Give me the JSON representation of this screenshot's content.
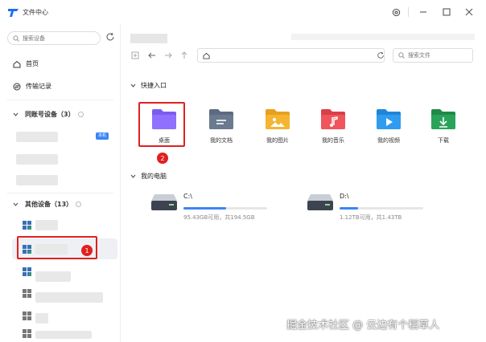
{
  "app": {
    "title": "文件中心"
  },
  "sidebar": {
    "search_placeholder": "搜索设备",
    "nav": [
      {
        "label": "首页",
        "icon": "home-icon"
      },
      {
        "label": "传输记录",
        "icon": "transfer-icon"
      }
    ],
    "groups": [
      {
        "label": "同账号设备（3）"
      },
      {
        "label": "其他设备（13）"
      }
    ],
    "badge": "本机"
  },
  "main": {
    "search_placeholder": "搜索文件",
    "quick_access": {
      "label": "快捷入口",
      "items": [
        {
          "label": "桌面",
          "color": "#7b5cf0"
        },
        {
          "label": "我的文档",
          "color": "#6b7a8f"
        },
        {
          "label": "我的图片",
          "color": "#f5b431"
        },
        {
          "label": "我的音乐",
          "color": "#f0555c"
        },
        {
          "label": "我的视频",
          "color": "#2f9cf0"
        },
        {
          "label": "下载",
          "color": "#2aa35a"
        }
      ]
    },
    "my_computer": {
      "label": "我的电脑",
      "drives": [
        {
          "name": "C:\\",
          "usage": "95.43GB可用，共194.5GB",
          "used_fraction": 0.51
        },
        {
          "name": "D:\\",
          "usage": "1.12TB可用，共1.43TB",
          "used_fraction": 0.22
        }
      ]
    }
  },
  "annotations": {
    "marker_1": "1",
    "marker_2": "2"
  },
  "watermark": "掘金技术社区 @ 云边有个稻草人",
  "colors": {
    "accent": "#3a86f5",
    "annotation_red": "#e02020"
  }
}
